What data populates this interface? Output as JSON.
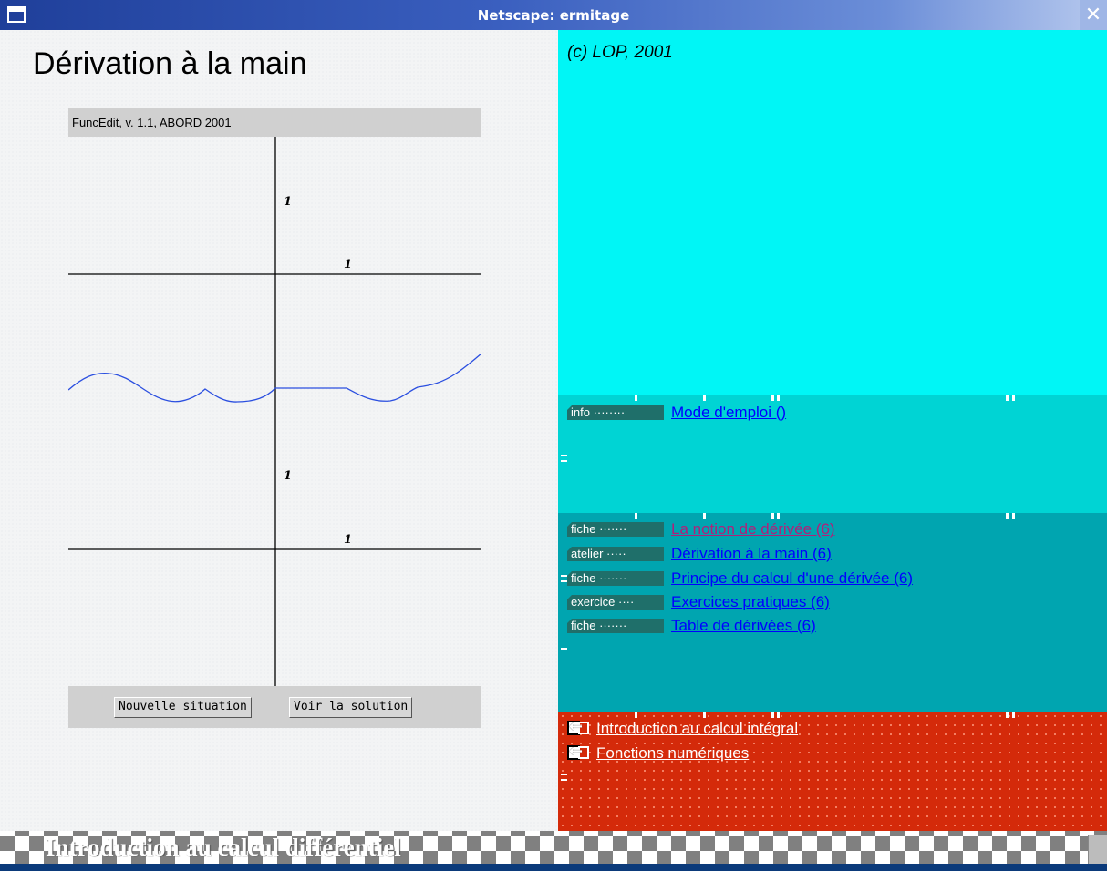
{
  "window": {
    "title": "Netscape: ermitage"
  },
  "left": {
    "page_title": "Dérivation à la main",
    "applet": {
      "header": "FuncEdit, v. 1.1, ABORD 2001",
      "axis_labels": {
        "upper_y": "1",
        "upper_x": "1",
        "lower_y": "1",
        "lower_x": "1"
      },
      "buttons": {
        "new_situation": "Nouvelle situation",
        "see_solution": "Voir la solution"
      },
      "curve_color": "#2b4fe0"
    }
  },
  "right": {
    "copyright": "(c) LOP, 2001",
    "info_section": {
      "items": [
        {
          "tag": "info",
          "label": "Mode d'emploi ()"
        }
      ]
    },
    "fiche_section": {
      "items": [
        {
          "tag": "fiche",
          "label": "La notion de dérivée (6)"
        },
        {
          "tag": "atelier",
          "label": "Dérivation à la main (6)"
        },
        {
          "tag": "fiche",
          "label": "Principe du calcul d'une dérivée (6)"
        },
        {
          "tag": "exercice",
          "label": "Exercices pratiques (6)"
        },
        {
          "tag": "fiche",
          "label": "Table de dérivées (6)"
        }
      ]
    },
    "link_section": {
      "items": [
        {
          "label": "Introduction au calcul intégral"
        },
        {
          "label": "Fonctions numériques"
        }
      ]
    },
    "colors": {
      "top": "#00f6f6",
      "info": "#00d4d4",
      "fiche": "#00a5b0",
      "links": "#d42a0a",
      "link": "#0000ff",
      "visited": "#b0207a"
    }
  },
  "bottom_bar": {
    "title": "Introduction au calcul différentiel"
  }
}
